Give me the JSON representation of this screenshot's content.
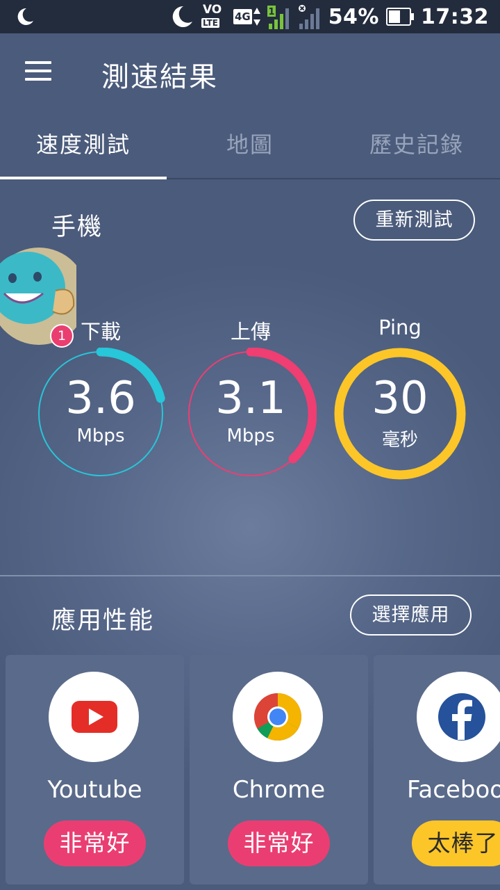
{
  "status_bar": {
    "volte": "VO",
    "lte": "LTE",
    "network": "4G",
    "sim_slot": "1",
    "battery": "54%",
    "time": "17:32"
  },
  "app_bar": {
    "title": "測速結果"
  },
  "tabs": [
    {
      "label": "速度測試",
      "active": true
    },
    {
      "label": "地圖",
      "active": false
    },
    {
      "label": "歷史記錄",
      "active": false
    }
  ],
  "phone_section": {
    "title": "手機",
    "retest_label": "重新測試",
    "notification_count": "1",
    "metrics": [
      {
        "label": "下載",
        "value": "3.6",
        "unit": "Mbps",
        "color": "#27c6d8",
        "fill_fraction": 0.21
      },
      {
        "label": "上傳",
        "value": "3.1",
        "unit": "Mbps",
        "color": "#ee3e72",
        "fill_fraction": 0.38
      },
      {
        "label": "Ping",
        "value": "30",
        "unit": "毫秒",
        "color": "#fcc628",
        "fill_fraction": 1.0
      }
    ]
  },
  "app_performance": {
    "title": "應用性能",
    "select_label": "選擇應用",
    "apps": [
      {
        "name": "Youtube",
        "rating": "非常好",
        "rating_color": "#ea3e72",
        "icon": "youtube-icon"
      },
      {
        "name": "Chrome",
        "rating": "非常好",
        "rating_color": "#ea3e72",
        "icon": "chrome-icon"
      },
      {
        "name": "Facebook",
        "rating": "太棒了",
        "rating_color": "#fcc628",
        "icon": "facebook-icon"
      }
    ]
  }
}
